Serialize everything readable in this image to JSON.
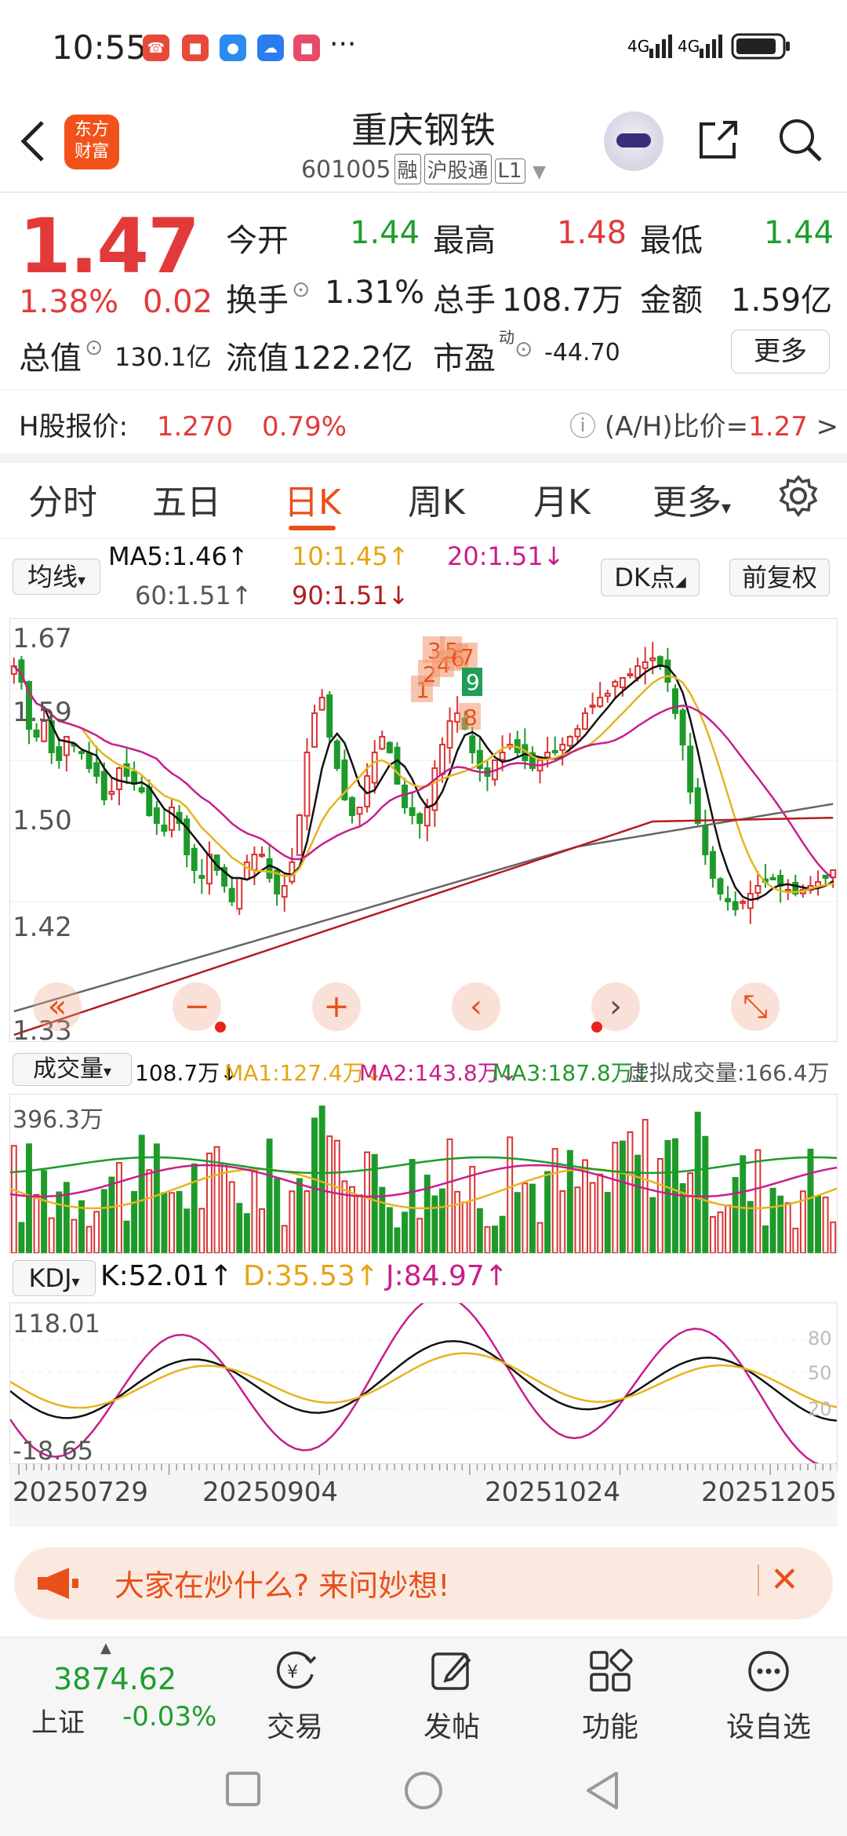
{
  "status_bar": {
    "time": "10:55",
    "more": "···"
  },
  "header": {
    "logo_line1": "东方",
    "logo_line2": "财富",
    "stock_name": "重庆钢铁",
    "stock_code": "601005",
    "tags": [
      "融",
      "沪股通",
      "L1"
    ]
  },
  "quote": {
    "price": "1.47",
    "pct": "1.38%",
    "change": "0.02",
    "open_label": "今开",
    "open": "1.44",
    "high_label": "最高",
    "high": "1.48",
    "low_label": "最低",
    "low": "1.44",
    "turnover_label": "换手",
    "turnover": "1.31%",
    "total_hands_label": "总手",
    "total_hands": "108.7万",
    "amount_label": "金额",
    "amount": "1.59亿",
    "total_value_label": "总值",
    "total_value": "130.1亿",
    "float_value_label": "流值",
    "float_value": "122.2亿",
    "pe_label": "市盈",
    "pe_sup": "动",
    "pe": "-44.70",
    "more_button": "更多"
  },
  "h_share": {
    "label": "H股报价:",
    "price": "1.270",
    "pct": "0.79%",
    "ratio_label": "(A/H)比价=",
    "ratio": "1.27",
    "arrow": ">"
  },
  "tabs": [
    "分时",
    "五日",
    "日K",
    "周K",
    "月K",
    "更多"
  ],
  "ma_legend": {
    "button": "均线",
    "ma5": "MA5:1.46↑",
    "ma10": "10:1.45↑",
    "ma20": "20:1.51↓",
    "ma60": "60:1.51↑",
    "ma90": "90:1.51↓",
    "dk_button": "DK点",
    "fq_button": "前复权"
  },
  "kchart": {
    "y_labels": [
      "1.67",
      "1.59",
      "1.50",
      "1.42",
      "1.33"
    ],
    "markers": [
      "1",
      "2",
      "3",
      "4",
      "5",
      "6",
      "7",
      "8",
      "9"
    ],
    "colors": {
      "up": "#d93434",
      "down": "#1e9a2a",
      "ma5": "#111111",
      "ma10": "#e6b41e",
      "ma20": "#c81e8c",
      "ma60": "#666666",
      "ma90": "#b01e1e"
    }
  },
  "volume": {
    "button": "成交量",
    "vol": "108.7万↓",
    "ma1": "MA1:127.4万↓",
    "ma2": "MA2:143.8万↓",
    "ma3": "MA3:187.8万↓",
    "virtual": "虚拟成交量:166.4万",
    "y_max": "396.3万"
  },
  "kdj": {
    "button": "KDJ",
    "k": "K:52.01↑",
    "d": "D:35.53↑",
    "j": "J:84.97↑",
    "y_max": "118.01",
    "y_min": "-18.65",
    "levels": [
      "80",
      "50",
      "20"
    ]
  },
  "dates": [
    "20250729",
    "20250904",
    "20251024",
    "20251205"
  ],
  "banner": {
    "text": "大家在炒什么? 来问妙想!"
  },
  "bottom": {
    "index_value": "3874.62",
    "index_name": "上证",
    "index_change": "-0.03%",
    "items": [
      "交易",
      "发帖",
      "功能",
      "设自选"
    ]
  }
}
